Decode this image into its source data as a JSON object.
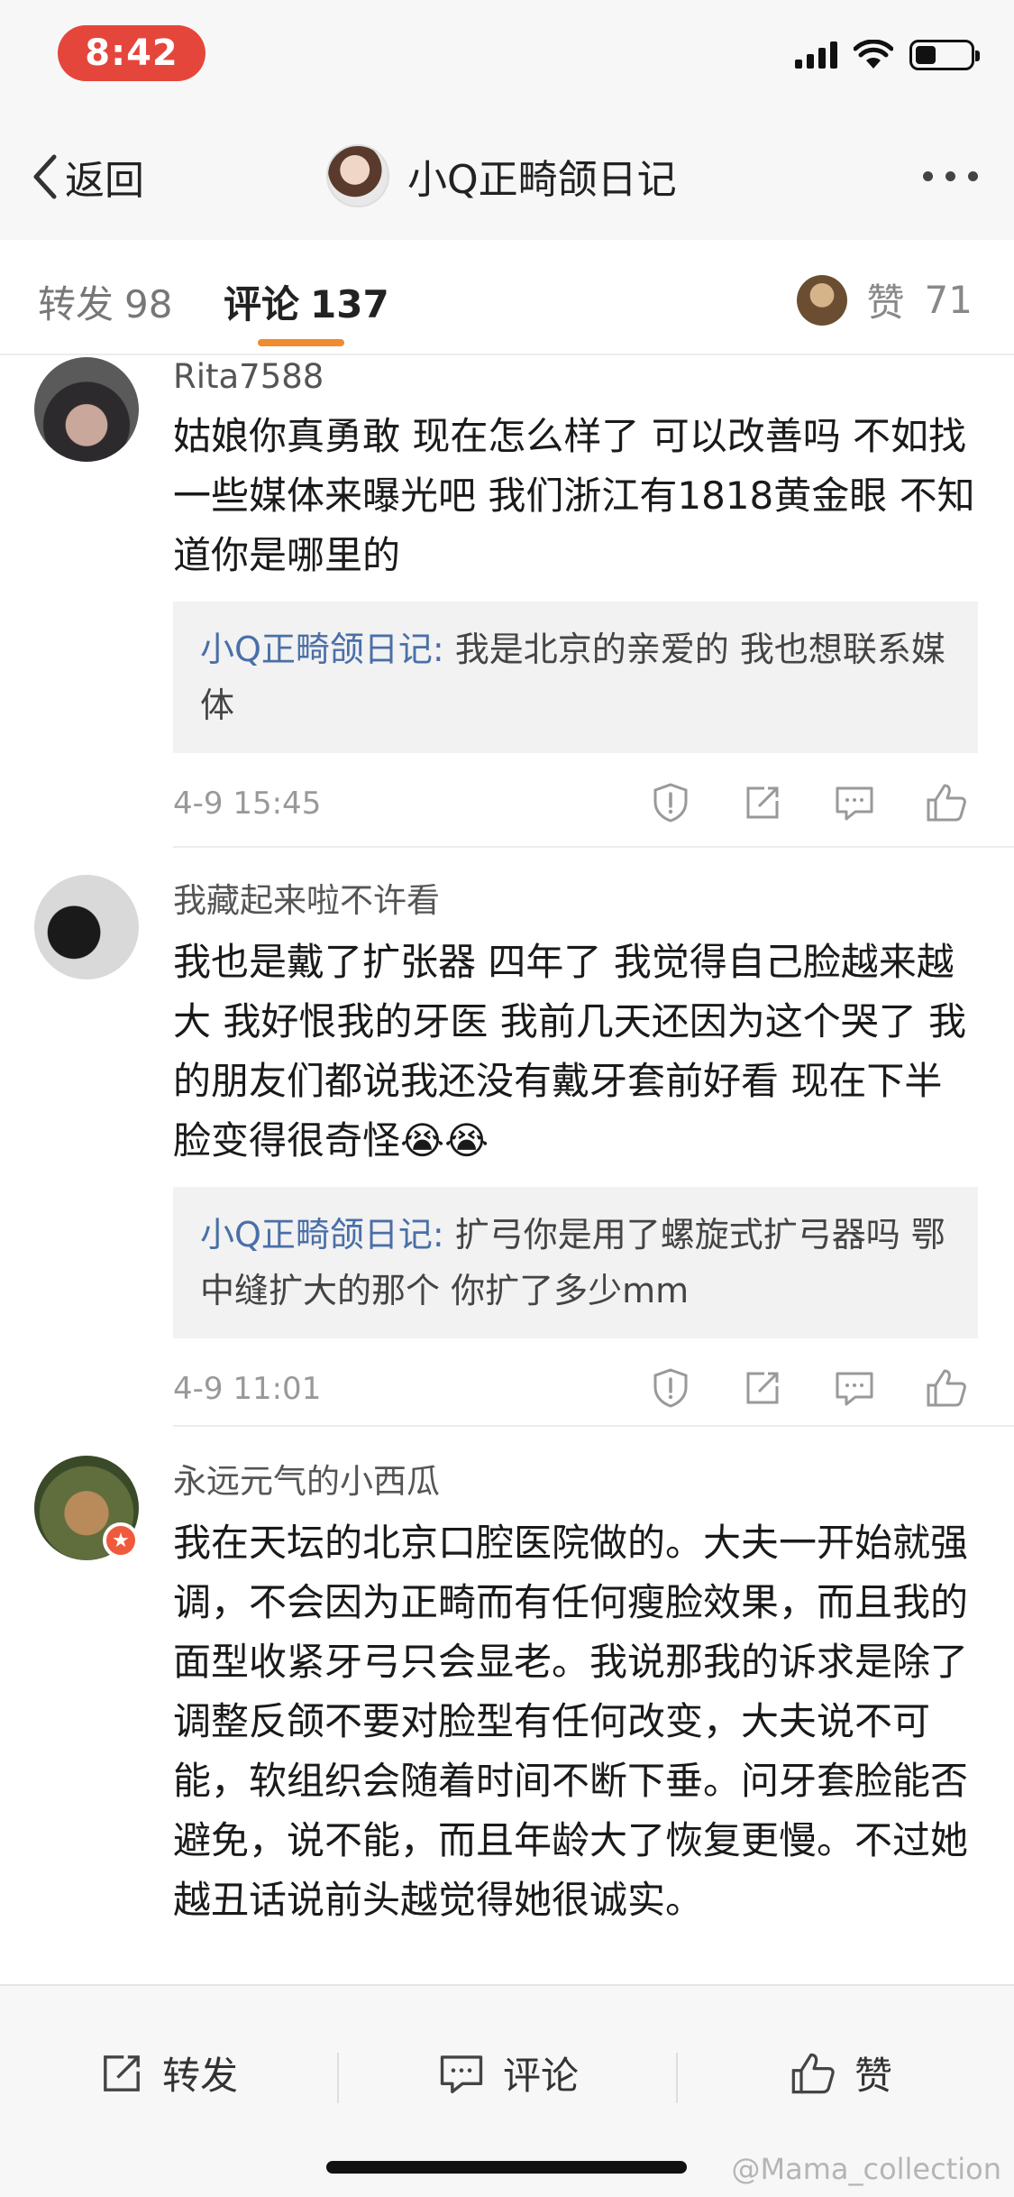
{
  "status_bar": {
    "time": "8:42"
  },
  "nav": {
    "back_label": "返回",
    "title": "小Q正畸颌日记"
  },
  "tabs": {
    "repost": {
      "label": "转发",
      "count": "98"
    },
    "comment": {
      "label": "评论",
      "count": "137"
    },
    "like": {
      "label": "赞",
      "count": "71"
    }
  },
  "comments": [
    {
      "username": "Rita7588",
      "text": "姑娘你真勇敢 现在怎么样了 可以改善吗 不如找一些媒体来曝光吧 我们浙江有1818黄金眼 不知道你是哪里的",
      "reply": {
        "author": "小Q正畸颌日记:",
        "text": " 我是北京的亲爱的 我也想联系媒体"
      },
      "time": "4-9 15:45"
    },
    {
      "username": "我藏起来啦不许看",
      "text": "我也是戴了扩张器 四年了 我觉得自己脸越来越大 我好恨我的牙医 我前几天还因为这个哭了 我的朋友们都说我还没有戴牙套前好看 现在下半脸变得很奇怪😭😭",
      "reply": {
        "author": "小Q正畸颌日记:",
        "text": " 扩弓你是用了螺旋式扩弓器吗 鄂中缝扩大的那个 你扩了多少mm"
      },
      "time": "4-9 11:01"
    },
    {
      "username": "永远元气的小西瓜",
      "text": "我在天坛的北京口腔医院做的。大夫一开始就强调，不会因为正畸而有任何瘦脸效果，而且我的面型收紧牙弓只会显老。我说那我的诉求是除了调整反颌不要对脸型有任何改变，大夫说不可能，软组织会随着时间不断下垂。问牙套脸能否避免，说不能，而且年龄大了恢复更慢。不过她越丑话说前头越觉得她很诚实。"
    }
  ],
  "toolbar": {
    "repost": "转发",
    "comment": "评论",
    "like": "赞"
  },
  "watermark": "@Mama_collection",
  "colors": {
    "accent": "#f08b30",
    "time_pill": "#e5463c",
    "reply_author": "#4a6fa8"
  }
}
